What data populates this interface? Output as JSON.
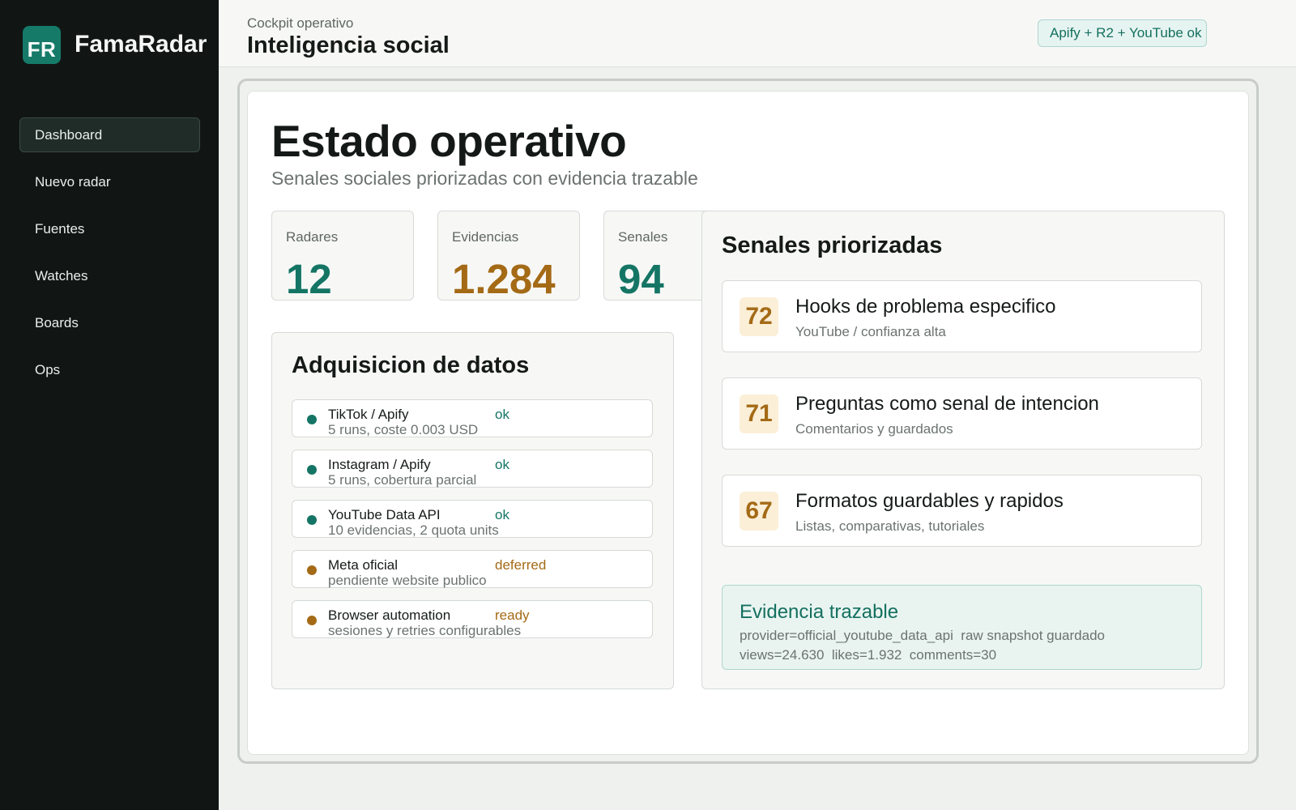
{
  "brand": {
    "logo": "FR",
    "name": "FamaRadar"
  },
  "sidebar": {
    "items": [
      {
        "label": "Dashboard",
        "active": true
      },
      {
        "label": "Nuevo radar"
      },
      {
        "label": "Fuentes"
      },
      {
        "label": "Watches"
      },
      {
        "label": "Boards"
      },
      {
        "label": "Ops"
      }
    ]
  },
  "header": {
    "breadcrumb": "Cockpit operativo",
    "title": "Inteligencia social",
    "status": "Apify + R2 + YouTube ok"
  },
  "hero": {
    "title": "Estado operativo",
    "subtitle": "Senales sociales priorizadas con evidencia trazable"
  },
  "stats": [
    {
      "label": "Radares",
      "value": "12"
    },
    {
      "label": "Evidencias",
      "value": "1.284"
    },
    {
      "label": "Senales",
      "value": "94"
    }
  ],
  "acquisition": {
    "title": "Adquisicion de datos",
    "sources": [
      {
        "name": "TikTok / Apify",
        "detail": "5 runs, coste 0.003 USD",
        "status": "ok"
      },
      {
        "name": "Instagram / Apify",
        "detail": "5 runs, cobertura parcial",
        "status": "ok"
      },
      {
        "name": "YouTube Data API",
        "detail": "10 evidencias, 2 quota units",
        "status": "ok"
      },
      {
        "name": "Meta oficial",
        "detail": "pendiente website publico",
        "status": "deferred"
      },
      {
        "name": "Browser automation",
        "detail": "sesiones y retries configurables",
        "status": "ready"
      }
    ]
  },
  "signals": {
    "title": "Senales priorizadas",
    "items": [
      {
        "score": "72",
        "title": "Hooks de problema especifico",
        "meta": "YouTube / confianza alta"
      },
      {
        "score": "71",
        "title": "Preguntas como senal de intencion",
        "meta": "Comentarios y guardados"
      },
      {
        "score": "67",
        "title": "Formatos guardables y rapidos",
        "meta": "Listas, comparativas, tutoriales"
      }
    ],
    "evidence": {
      "title": "Evidencia trazable",
      "line1": "provider=official_youtube_data_api  raw snapshot guardado",
      "line2": "views=24.630  likes=1.932  comments=30"
    }
  },
  "colors": {
    "sidebar_bg": "#111614",
    "accent_teal": "#157565",
    "accent_amber": "#a46a16",
    "status_ok": "#157565",
    "status_pending": "#a46a16"
  }
}
